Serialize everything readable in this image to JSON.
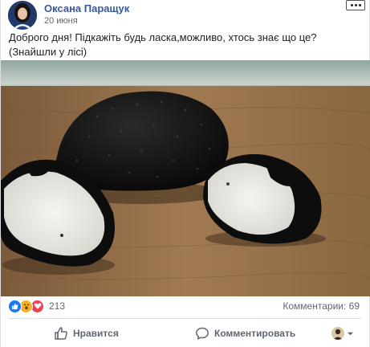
{
  "post": {
    "author": "Оксана Паращук",
    "time": "20 июня",
    "text_line1": "Доброго дня! Підкажіть будь ласка,можливо, хтось знає що це?",
    "text_line2": "(Знайшли у лісі)"
  },
  "reactions": {
    "icons": [
      "like-icon",
      "wow-icon",
      "love-icon"
    ],
    "count": "213",
    "comments": "Комментарии: 69"
  },
  "actions": {
    "like_label": "Нравится",
    "comment_label": "Комментировать"
  },
  "colors": {
    "author": "#385898",
    "like": "#1877f2",
    "love": "#f33e58",
    "wow": "#f7b125",
    "muted": "#606770"
  }
}
